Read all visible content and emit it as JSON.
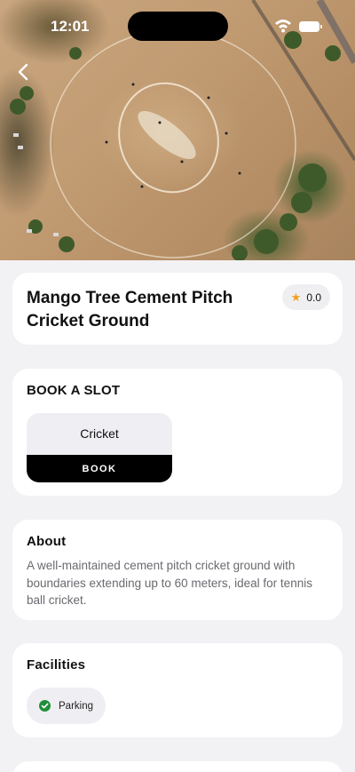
{
  "status_bar": {
    "time": "12:01",
    "icons": [
      "wifi-icon",
      "battery-icon"
    ]
  },
  "hero": {
    "image": "aerial-cricket-ground-photo",
    "back_icon": "chevron-left-icon"
  },
  "ground": {
    "name": "Mango Tree Cement Pitch Cricket Ground",
    "rating": "0.0",
    "rating_icon": "star-icon"
  },
  "booking": {
    "heading": "BOOK A SLOT",
    "slots": [
      {
        "sport": "Cricket",
        "button_label": "BOOK"
      }
    ]
  },
  "about": {
    "heading": "About",
    "text": "A well-maintained cement pitch cricket ground with boundaries extending up to 60 meters, ideal for tennis ball cricket."
  },
  "facilities": {
    "heading": "Facilities",
    "items": [
      {
        "label": "Parking",
        "icon": "check-circle-icon"
      }
    ]
  },
  "colors": {
    "accent": "#000000",
    "star": "#f0a020",
    "check": "#1f8f3a",
    "background": "#f2f2f5"
  }
}
